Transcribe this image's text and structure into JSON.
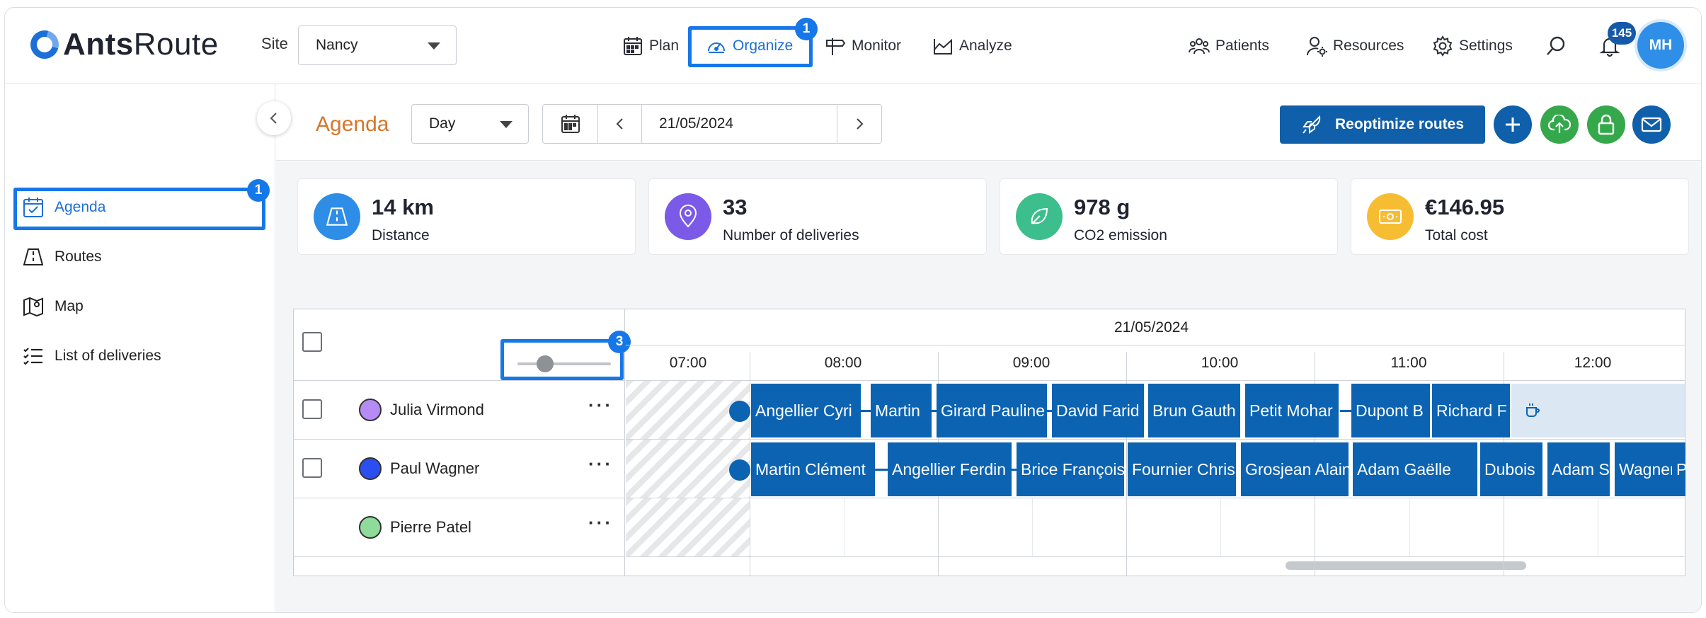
{
  "app": {
    "logo_text_bold": "Ants",
    "logo_text_light": "Route",
    "site_label": "Site",
    "site_value": "Nancy",
    "nav": [
      {
        "label": "Plan"
      },
      {
        "label": "Organize"
      },
      {
        "label": "Monitor"
      },
      {
        "label": "Analyze"
      }
    ],
    "right_nav": [
      {
        "label": "Patients"
      },
      {
        "label": "Resources"
      },
      {
        "label": "Settings"
      }
    ],
    "notification_count": "145",
    "avatar_initials": "MH"
  },
  "annotations": {
    "organize_badge": "1",
    "agenda_badge": "1",
    "slider_badge": "3",
    "color": "#1677e8"
  },
  "sidebar": {
    "items": [
      {
        "label": "Agenda",
        "icon": "calendar-check-icon"
      },
      {
        "label": "Routes",
        "icon": "road-icon"
      },
      {
        "label": "Map",
        "icon": "map-icon"
      },
      {
        "label": "List of deliveries",
        "icon": "checklist-icon"
      }
    ]
  },
  "subheader": {
    "title": "Agenda",
    "view_value": "Day",
    "date_value": "21/05/2024",
    "reoptimize_label": "Reoptimize routes"
  },
  "kpis": [
    {
      "value": "14 km",
      "label": "Distance",
      "color": "#2e8de6",
      "icon": "road-icon"
    },
    {
      "value": "33",
      "label": "Number of deliveries",
      "color": "#7a5ae6",
      "icon": "pin-icon"
    },
    {
      "value": "978 g",
      "label": "CO2 emission",
      "color": "#3cbf8c",
      "icon": "leaf-icon"
    },
    {
      "value": "€146.95",
      "label": "Total cost",
      "color": "#f7bd32",
      "icon": "banknote-icon"
    }
  ],
  "agenda": {
    "date_header": "21/05/2024",
    "hours": [
      "07:00",
      "08:00",
      "09:00",
      "10:00",
      "11:00",
      "12:00"
    ],
    "zoom_level": 0.25,
    "drivers": [
      {
        "name": "Julia Virmond",
        "color": "#b58cf5",
        "deliveries": [
          "Angellier Cyri",
          "Martin",
          "Girard Pauline",
          "David Farid",
          "Brun Gauth",
          "Petit Mohar",
          "Dupont B",
          "Richard F"
        ]
      },
      {
        "name": "Paul Wagner",
        "color": "#2b4ef0",
        "deliveries": [
          "Martin Clément",
          "Angellier Ferdin",
          "Brice François",
          "Fournier Chris",
          "Grosjean Alain",
          "Adam Gaëlle",
          "Dubois",
          "Adam S",
          "Wagner",
          "Pi"
        ]
      },
      {
        "name": "Pierre Patel",
        "color": "#8fdc9a",
        "deliveries": []
      }
    ],
    "break_icon": "coffee-icon"
  }
}
